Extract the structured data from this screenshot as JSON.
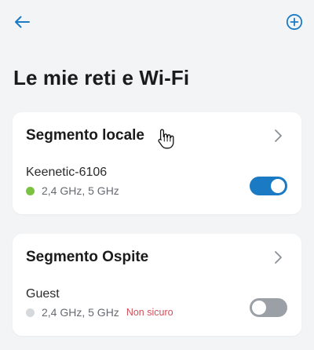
{
  "header": {
    "back_icon": "arrow-left-icon",
    "add_icon": "plus-circle-icon",
    "accent_color": "#1a7ac4"
  },
  "page": {
    "title": "Le mie reti e Wi-Fi"
  },
  "segments": [
    {
      "title": "Segmento locale",
      "network": {
        "name": "Keenetic-6106",
        "bands": "2,4 GHz, 5 GHz",
        "status_color": "#7cc242",
        "warning": "",
        "enabled": true
      }
    },
    {
      "title": "Segmento Ospite",
      "network": {
        "name": "Guest",
        "bands": "2,4 GHz, 5 GHz",
        "status_color": "#d6d9dc",
        "warning": "Non sicuro",
        "enabled": false
      }
    }
  ],
  "colors": {
    "toggle_on": "#1a7ac4",
    "toggle_off": "#9aa0a6",
    "warning": "#d0505a"
  }
}
